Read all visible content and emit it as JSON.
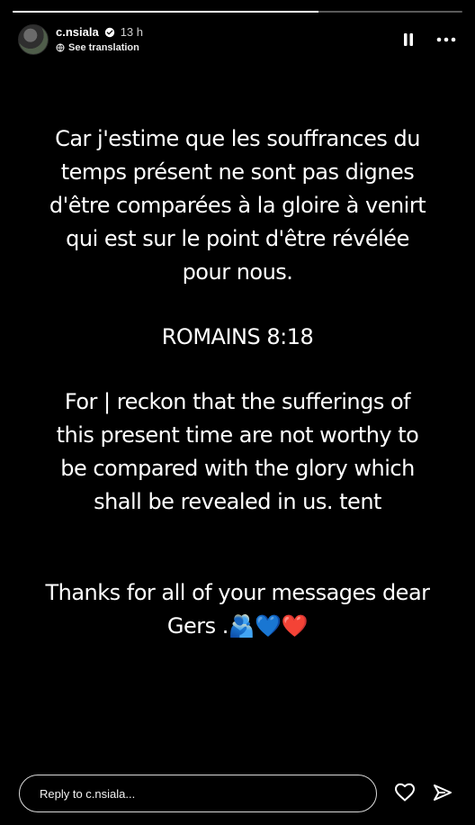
{
  "story": {
    "progress_fraction": 0.68
  },
  "header": {
    "username": "c.nsiala",
    "time": "13 h",
    "translation_label": "See translation",
    "icons": {
      "verified": "verified-icon",
      "globe": "globe-icon",
      "pause": "pause-icon",
      "more": "more-icon"
    }
  },
  "content": {
    "paragraph_1": "Car j'estime que les souffrances du\ntemps présent ne sont pas dignes\nd'être comparées à la gloire à venirt\nqui est sur le point d'être révélée\npour nous.",
    "reference": "ROMAINS 8:18",
    "paragraph_2": "For | reckon that the sufferings of\nthis present time are not worthy to\nbe compared with the glory which\nshall be revealed in us. tent",
    "paragraph_3": "Thanks for all of your messages dear\nGers .🫂💙❤️"
  },
  "reply": {
    "placeholder": "Reply to c.nsiala..."
  },
  "footer": {
    "icons": {
      "heart": "heart-icon",
      "send": "send-icon"
    }
  },
  "colors": {
    "background": "#000000",
    "text": "#ffffff",
    "muted_text": "#cfcfcf",
    "verified": "#1d9bf0"
  }
}
